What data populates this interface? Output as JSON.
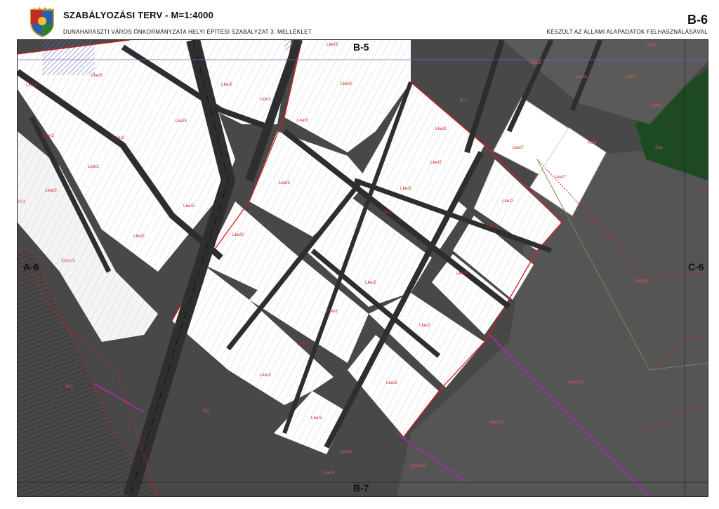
{
  "header": {
    "title": "SZABÁLYOZÁSI TERV   -   M=1:4000",
    "subtitle": "DUNAHARASZTI VÁROS ÖNKORMÁNYZATA HELYI ÉPÍTÉSI SZABÁLYZAT 3. MELLÉKLET",
    "sheet_code": "B-6",
    "source_note": "KÉSZÜLT AZ ÁLLAMI ALAPADATOK FELHASZNÁLÁSÁVAL"
  },
  "neighbors": {
    "north": "B-5",
    "south": "B-7",
    "west": "A-6",
    "east": "C-6"
  },
  "zones": {
    "lke2": "Lke/2",
    "lke3": "Lke/3",
    "lke6": "Lke/6",
    "lke7": "Lke/7",
    "mai": "Má/Sz1",
    "kt": "K-T",
    "vi": "Vi/1",
    "eg": "Eg",
    "zkp": "Zkp",
    "gksz": "Gksz/1",
    "kko": "KKö"
  },
  "colors": {
    "background": "#ffffff",
    "map_dark": "#484848",
    "parcel_white": "#ffffff",
    "road": "#2e2e2e",
    "zone_border": "#e01b1b",
    "forest": "#1e4a22",
    "blue_hatch": "#8a8ad8",
    "utility_line": "#b02ab0"
  }
}
